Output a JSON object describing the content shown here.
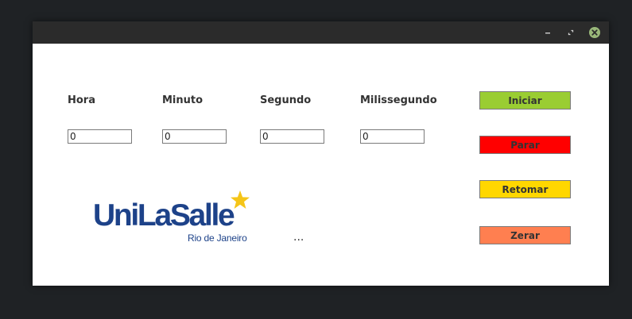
{
  "window": {
    "controls": {
      "minimize_icon": "minimize-icon",
      "maximize_icon": "restore-icon",
      "close_icon": "close-icon"
    }
  },
  "fields": [
    {
      "label": "Hora",
      "value": "0"
    },
    {
      "label": "Minuto",
      "value": "0"
    },
    {
      "label": "Segundo",
      "value": "0"
    },
    {
      "label": "Milissegundo",
      "value": "0"
    }
  ],
  "buttons": {
    "start": {
      "label": "Iniciar",
      "color": "#9acd32"
    },
    "stop": {
      "label": "Parar",
      "color": "#ff0000"
    },
    "resume": {
      "label": "Retomar",
      "color": "#ffd700"
    },
    "reset": {
      "label": "Zerar",
      "color": "#ff7f50"
    }
  },
  "logo": {
    "name": "UniLaSalle",
    "subtitle": "Rio de Janeiro",
    "brand_color": "#1d4289",
    "star_color": "#f5c518"
  },
  "status_text": "..."
}
